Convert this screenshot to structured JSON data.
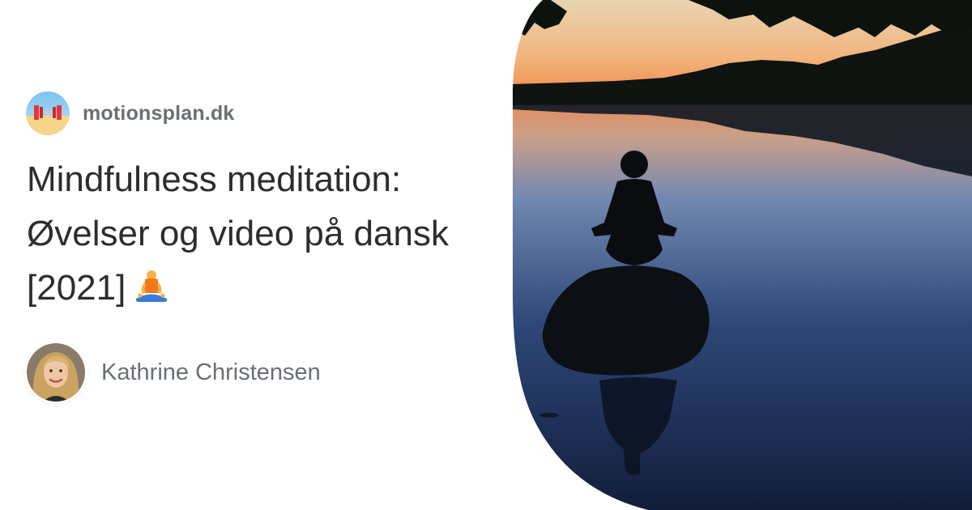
{
  "site": {
    "name": "motionsplan.dk",
    "logo_icon": "dumbbell-beach-icon"
  },
  "article": {
    "title_line1": "Mindfulness meditation:",
    "title_line2": "Øvelser og video på dansk",
    "title_line3": "[2021]",
    "title_emoji_icon": "person-in-lotus-position-icon"
  },
  "author": {
    "name": "Kathrine Christensen",
    "avatar_icon": "author-portrait"
  },
  "hero_image": {
    "subject": "meditation-lake-silhouette"
  },
  "colors": {
    "title": "#2b2d30",
    "muted": "#6b6f74",
    "sky_top": "#f2c99a",
    "sky_horizon": "#f3a06a",
    "water": "#1b2a4a"
  }
}
